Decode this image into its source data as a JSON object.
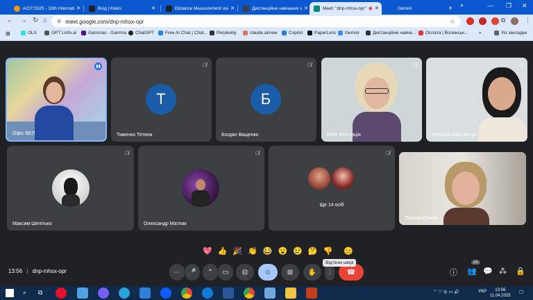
{
  "tabs": [
    {
      "title": "ACIT'2025 - 15th Internati",
      "color": "#f29900"
    },
    {
      "title": "Вхід | Kleks",
      "color": "#202124"
    },
    {
      "title": "Distance Measurement usi",
      "color": "#202124"
    },
    {
      "title": "Дистанційне навчання з",
      "color": "#3c4043"
    },
    {
      "title": "Meet: \"dnp-mhsx-opr\"",
      "color": "#00897b"
    },
    {
      "title": "Gemini",
      "color": "#8ab4f8"
    }
  ],
  "url": "meet.google.com/dnp-mhsx-opr",
  "bookmarks": [
    "OLX",
    "GPT Linfo.ai",
    "Gammas - Gamma",
    "ChatGPT",
    "Free AI Chat | Chat...",
    "Perplexity",
    "claude.ai/new",
    "Copilot",
    "PaperLess",
    "Gemini",
    "Дистанційне навча...",
    "Оплата | Волинськ..."
  ],
  "all_bookmarks": "Усі закладки",
  "participants": [
    {
      "name": "Офіс ВЕЛ"
    },
    {
      "name": "Тимочко Тетяна",
      "initial": "Т"
    },
    {
      "name": "Богдан Ващенко",
      "initial": "Б"
    },
    {
      "name": "КІФК Атестація"
    },
    {
      "name": "Наталка Максимчук"
    },
    {
      "name": "Максим Шепітько"
    },
    {
      "name": "Олександр Матлак"
    },
    {
      "name": "Оксана Громик"
    }
  ],
  "others": "Ще 14 осіб",
  "meeting_time": "13:56",
  "meeting_code": "dnp-mhsx-opr",
  "reactions": [
    "💖",
    "👍",
    "🎉",
    "👏",
    "😂",
    "😮",
    "😢",
    "🤔",
    "👎",
    "😐"
  ],
  "tooltip": "Відтінок шкірі",
  "people_count": "22",
  "taskbar": {
    "lang": "УКР",
    "time": "13:56",
    "date": "11.04.2025"
  }
}
